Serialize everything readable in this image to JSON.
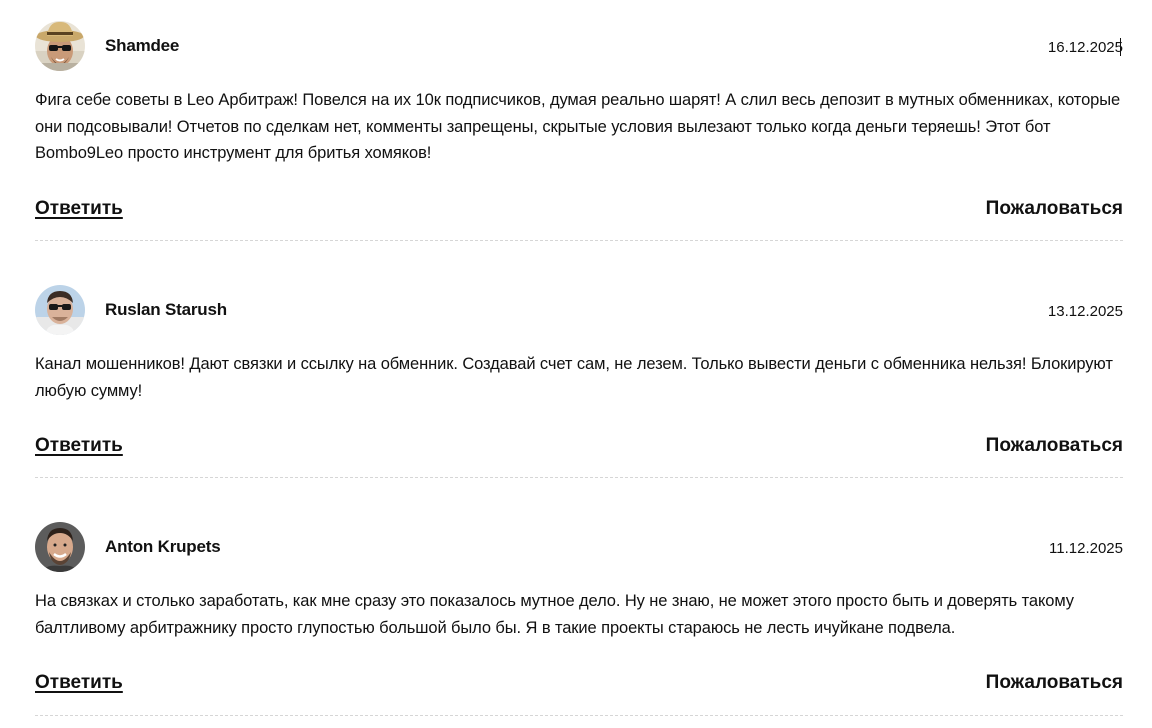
{
  "comments": [
    {
      "author": "Shamdee",
      "date": "16.12.2025",
      "text": "Фига себе советы в Leo Арбитраж! Повелся на их 10к подписчиков, думая реально шарят! А слил весь депозит в мутных обменниках, которые они подсовывали! Отчетов по сделкам нет, комменты запрещены, скрытые условия вылезают только когда деньги теряешь! Этот бот Bombo9Leo просто инструмент для бритья хомяков!",
      "reply_label": "Ответить",
      "report_label": "Пожаловаться",
      "avatar_icon": "avatar-man-hat-sunglasses"
    },
    {
      "author": "Ruslan Starush",
      "date": "13.12.2025",
      "text": "Канал мошенников! Дают связки и ссылку на обменник. Создавай счет сам, не лезем. Только вывести деньги с обменника нельзя! Блокируют любую сумму!",
      "reply_label": "Ответить",
      "report_label": "Пожаловаться",
      "avatar_icon": "avatar-man-sunglasses"
    },
    {
      "author": "Anton Krupets",
      "date": "11.12.2025",
      "text": "На связках и столько заработать, как мне сразу это показалось мутное дело. Ну не знаю, не может этого просто быть и доверять такому балтливому арбитражнику просто глупостью большой было бы. Я в такие проекты стараюсь не лесть ичуйкане подвела.",
      "reply_label": "Ответить",
      "report_label": "Пожаловаться",
      "avatar_icon": "avatar-man-smiling"
    }
  ],
  "colors": {
    "text": "#111111",
    "divider": "#d6d6d6",
    "background": "#ffffff"
  }
}
